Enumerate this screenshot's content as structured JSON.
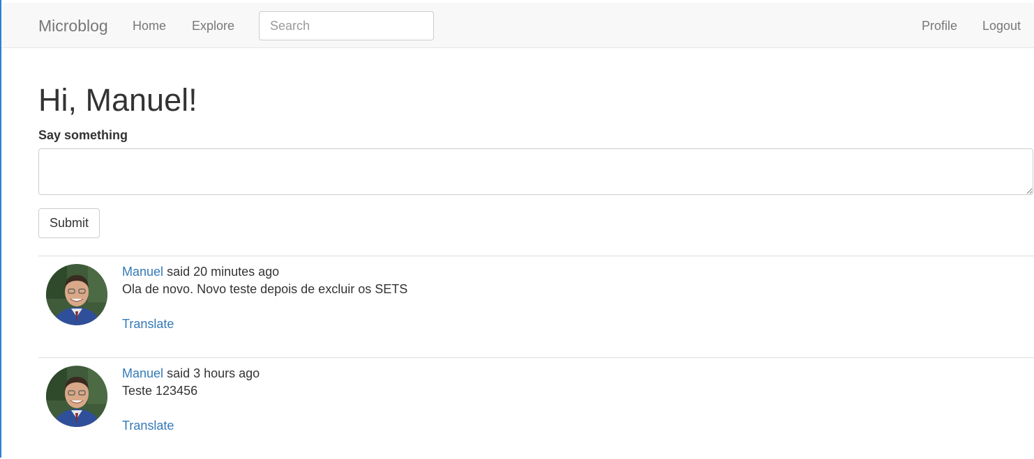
{
  "navbar": {
    "brand": "Microblog",
    "links": {
      "home": "Home",
      "explore": "Explore",
      "profile": "Profile",
      "logout": "Logout"
    },
    "search": {
      "placeholder": "Search",
      "value": ""
    }
  },
  "main": {
    "greeting": "Hi, Manuel!",
    "form": {
      "label": "Say something",
      "textarea_value": "",
      "submit_label": "Submit"
    },
    "posts": [
      {
        "author": "Manuel",
        "said_text": "said 20 minutes ago",
        "body": "Ola de novo. Novo teste depois de excluir os SETS",
        "translate_label": "Translate"
      },
      {
        "author": "Manuel",
        "said_text": "said 3 hours ago",
        "body": "Teste 123456",
        "translate_label": "Translate"
      }
    ]
  },
  "colors": {
    "link": "#337ab7",
    "navbar_bg": "#f8f8f8",
    "nav_text": "#777777",
    "text": "#333333"
  }
}
